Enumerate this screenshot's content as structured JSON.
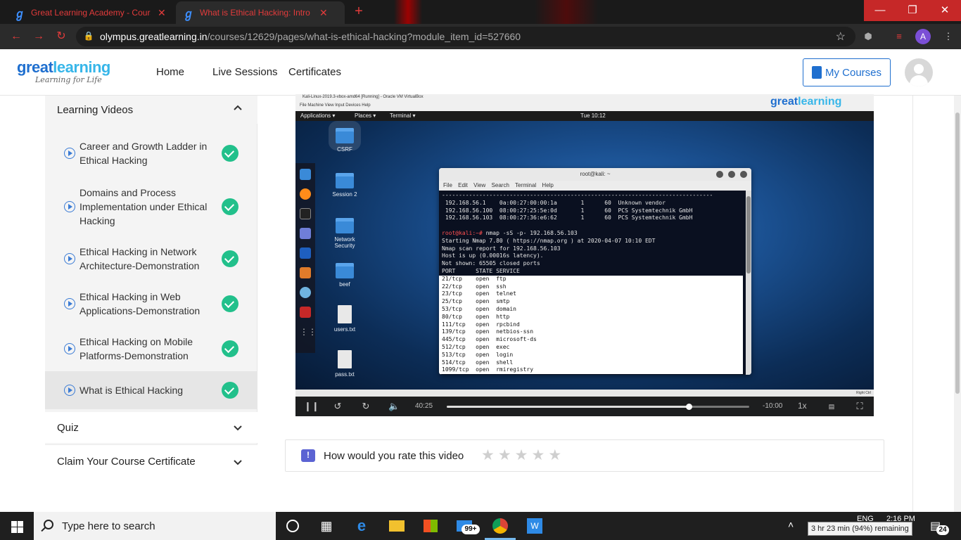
{
  "browser": {
    "tabs": [
      {
        "title": "Great Learning Academy - Cours",
        "close": "✕",
        "active": false
      },
      {
        "title": "What is Ethical Hacking: Intro",
        "close": "✕",
        "active": true
      }
    ],
    "new_tab": "+",
    "url_host": "olympus.greatlearning.in",
    "url_path": "/courses/12629/pages/what-is-ethical-hacking?module_item_id=527660",
    "profile_initial": "A"
  },
  "site": {
    "logo_main_a": "great",
    "logo_main_b": "learning",
    "logo_tagline": "Learning for Life",
    "nav": [
      "Home",
      "Live Sessions",
      "Certificates"
    ],
    "my_courses": "My Courses"
  },
  "sidebar": {
    "learning_videos": "Learning Videos",
    "lessons": [
      {
        "title": "Career and Growth Ladder in Ethical Hacking",
        "completed": true
      },
      {
        "title": "Domains and Process Implementation under Ethical Hacking",
        "completed": true
      },
      {
        "title": "Ethical Hacking in Network Architecture-Demonstration",
        "completed": true
      },
      {
        "title": "Ethical Hacking in Web Applications-Demonstration",
        "completed": true
      },
      {
        "title": "Ethical Hacking on Mobile Platforms-Demonstration",
        "completed": true
      },
      {
        "title": "What is Ethical Hacking",
        "completed": true,
        "active": true
      }
    ],
    "quiz": "Quiz",
    "certificate": "Claim Your Course Certificate"
  },
  "video": {
    "vm_title": "Kali-Linux-2019.3-vbox-amd64 [Running] - Oracle VM VirtualBox",
    "vm_menu": "File   Machine   View   Input   Devices   Help",
    "watermark_a": "great",
    "watermark_b": "learning",
    "kali_applications": "Applications ▾",
    "kali_places": "Places ▾",
    "kali_terminal": "Terminal ▾",
    "kali_clock": "Tue 10:12",
    "desktop_icons": [
      "CSRF",
      "Session 2",
      "Network Security",
      "beef",
      "users.txt",
      "pass.txt"
    ],
    "terminal": {
      "title": "root@kali: ~",
      "menu": "File Edit View Search Terminal Help",
      "pre_lines": [
        "--------------------------------------------------------------------------------",
        " 192.168.56.1    0a:00:27:00:00:1a       1      60  Unknown vendor",
        " 192.168.56.100  08:00:27:25:5e:0d       1      60  PCS Systemtechnik GmbH",
        " 192.168.56.103  08:00:27:36:e6:62       1      60  PCS Systemtechnik GmbH",
        ""
      ],
      "prompt": "root@kali:~#",
      "command": " nmap -sS -p- 192.168.56.103",
      "output_lines": [
        "Starting Nmap 7.80 ( https://nmap.org ) at 2020-04-07 10:10 EDT",
        "Nmap scan report for 192.168.56.103",
        "Host is up (0.00016s latency).",
        "Not shown: 65505 closed ports",
        "PORT      STATE SERVICE"
      ],
      "selected_lines": [
        "21/tcp    open  ftp",
        "22/tcp    open  ssh",
        "23/tcp    open  telnet",
        "25/tcp    open  smtp",
        "53/tcp    open  domain",
        "80/tcp    open  http",
        "111/tcp   open  rpcbind",
        "139/tcp   open  netbios-ssn",
        "445/tcp   open  microsoft-ds",
        "512/tcp   open  exec",
        "513/tcp   open  login",
        "514/tcp   open  shell",
        "1099/tcp  open  rmiregistry"
      ]
    },
    "vm_status": "Right Ctrl",
    "player": {
      "elapsed": "40:25",
      "remaining": "-10:00",
      "speed": "1x",
      "progress_fraction": 0.8
    }
  },
  "rating": {
    "question": "How would you rate this video",
    "stars_total": 5,
    "stars": [
      "★",
      "★",
      "★",
      "★",
      "★"
    ]
  },
  "taskbar": {
    "search_placeholder": "Type here to search",
    "store_badge": "99+",
    "lang": "ENG",
    "time": "2:16 PM",
    "battery_tooltip": "3 hr 23 min (94%) remaining",
    "notifications": "24"
  }
}
